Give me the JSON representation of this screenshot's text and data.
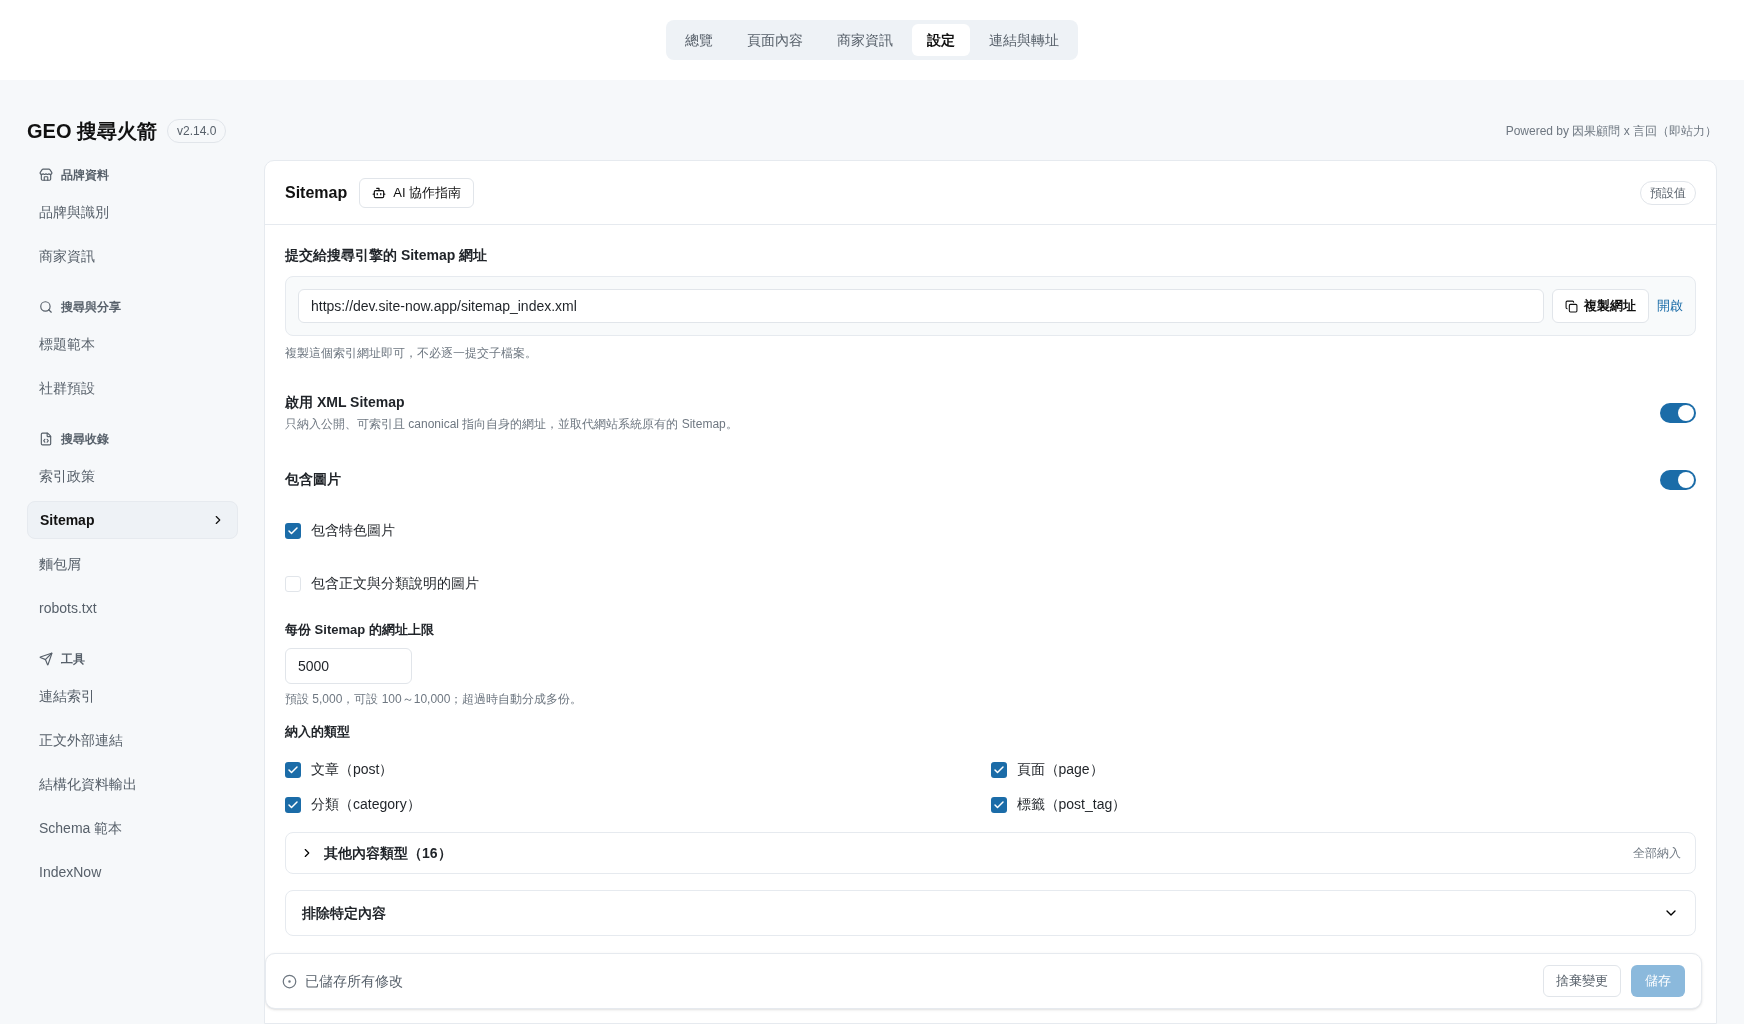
{
  "top_tabs": [
    {
      "label": "總覽",
      "selected": false
    },
    {
      "label": "頁面內容",
      "selected": false
    },
    {
      "label": "商家資訊",
      "selected": false
    },
    {
      "label": "設定",
      "selected": true
    },
    {
      "label": "連結與轉址",
      "selected": false
    }
  ],
  "header": {
    "title": "GEO 搜尋火箭",
    "version": "v2.14.0",
    "powered_by": "Powered by 因果顧問 x 言回（即站力）"
  },
  "sidebar": {
    "sections": [
      {
        "title": "品牌資料",
        "items": [
          {
            "label": "品牌與識別",
            "selected": false
          },
          {
            "label": "商家資訊",
            "selected": false
          }
        ]
      },
      {
        "title": "搜尋與分享",
        "items": [
          {
            "label": "標題範本",
            "selected": false
          },
          {
            "label": "社群預設",
            "selected": false
          }
        ]
      },
      {
        "title": "搜尋收錄",
        "items": [
          {
            "label": "索引政策",
            "selected": false
          },
          {
            "label": "Sitemap",
            "selected": true
          },
          {
            "label": "麵包屑",
            "selected": false
          },
          {
            "label": "robots.txt",
            "selected": false
          }
        ]
      },
      {
        "title": "工具",
        "items": [
          {
            "label": "連結索引",
            "selected": false
          },
          {
            "label": "正文外部連結",
            "selected": false
          },
          {
            "label": "結構化資料輸出",
            "selected": false
          },
          {
            "label": "Schema 範本",
            "selected": false
          },
          {
            "label": "IndexNow",
            "selected": false
          }
        ]
      }
    ]
  },
  "panel": {
    "title": "Sitemap",
    "guide_button": "AI 協作指南",
    "default_badge": "預設值",
    "url_label": "提交給搜尋引擎的 Sitemap 網址",
    "url_value": "https://dev.site-now.app/sitemap_index.xml",
    "copy_button": "複製網址",
    "open_link": "開啟",
    "url_hint": "複製這個索引網址即可，不必逐一提交子檔案。",
    "xml_toggle": {
      "label": "啟用 XML Sitemap",
      "description": "只納入公開、可索引且 canonical 指向自身的網址，並取代網站系統原有的 Sitemap。",
      "on": true
    },
    "images_toggle": {
      "label": "包含圖片",
      "on": true
    },
    "image_options": [
      {
        "label": "包含特色圖片",
        "checked": true
      },
      {
        "label": "包含正文與分類說明的圖片",
        "checked": false
      }
    ],
    "limit_label": "每份 Sitemap 的網址上限",
    "limit_value": "5000",
    "limit_hint": "預設 5,000，可設 100～10,000；超過時自動分成多份。",
    "types_label": "納入的類型",
    "types": [
      {
        "label": "文章（post）",
        "checked": true
      },
      {
        "label": "頁面（page）",
        "checked": true
      },
      {
        "label": "分類（category）",
        "checked": true
      },
      {
        "label": "標籤（post_tag）",
        "checked": true
      }
    ],
    "other_types": {
      "label": "其他內容類型（16）",
      "expanded": false,
      "action": "全部納入"
    },
    "exclusion": {
      "title": "排除特定內容",
      "expanded": false
    }
  },
  "save_bar": {
    "status": "已儲存所有修改",
    "discard": "捨棄變更",
    "save": "儲存",
    "save_disabled": true
  }
}
